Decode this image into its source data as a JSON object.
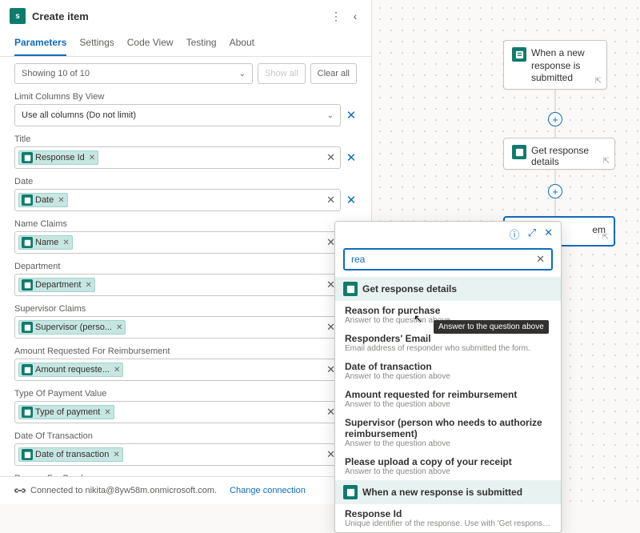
{
  "header": {
    "title": "Create item"
  },
  "tabs": [
    "Parameters",
    "Settings",
    "Code View",
    "Testing",
    "About"
  ],
  "activeTab": 0,
  "showing": {
    "text": "Showing 10 of 10",
    "showAll": "Show all",
    "clearAll": "Clear all"
  },
  "fields": [
    {
      "label": "Limit Columns By View",
      "type": "dropdown",
      "value": "Use all columns (Do not limit)"
    },
    {
      "label": "Title",
      "type": "token",
      "token": "Response Id"
    },
    {
      "label": "Date",
      "type": "token",
      "token": "Date"
    },
    {
      "label": "Name Claims",
      "type": "token",
      "token": "Name"
    },
    {
      "label": "Department",
      "type": "token",
      "token": "Department"
    },
    {
      "label": "Supervisor Claims",
      "type": "token",
      "token": "Supervisor (perso..."
    },
    {
      "label": "Amount Requested For Reimbursement",
      "type": "token",
      "token": "Amount requeste..."
    },
    {
      "label": "Type Of Payment Value",
      "type": "token",
      "token": "Type of payment"
    },
    {
      "label": "Date Of Transaction",
      "type": "token",
      "token": "Date of transaction"
    },
    {
      "label": "Reason For Purchase",
      "type": "empty"
    }
  ],
  "footer": {
    "text": "Connected to nikita@8yw58m.onmicrosoft.com.",
    "link": "Change connection"
  },
  "flow": {
    "card1": "When a new response is submitted",
    "card2": "Get response details",
    "card3": "em"
  },
  "popover": {
    "search": "rea",
    "section1": "Get response details",
    "items": [
      {
        "title": "Reason for purchase",
        "desc": "Answer to the question above"
      },
      {
        "title": "Responders' Email",
        "desc": "Email address of responder who submitted the form."
      },
      {
        "title": "Date of transaction",
        "desc": "Answer to the question above"
      },
      {
        "title": "Amount requested for reimbursement",
        "desc": "Answer to the question above"
      },
      {
        "title": "Supervisor (person who needs to authorize reimbursement)",
        "desc": "Answer to the question above"
      },
      {
        "title": "Please upload a copy of your receipt",
        "desc": "Answer to the question above"
      }
    ],
    "section2": "When a new response is submitted",
    "items2": [
      {
        "title": "Response Id",
        "desc": "Unique identifier of the response. Use with 'Get response details' actio..."
      }
    ]
  },
  "tooltip": "Answer to the question above"
}
